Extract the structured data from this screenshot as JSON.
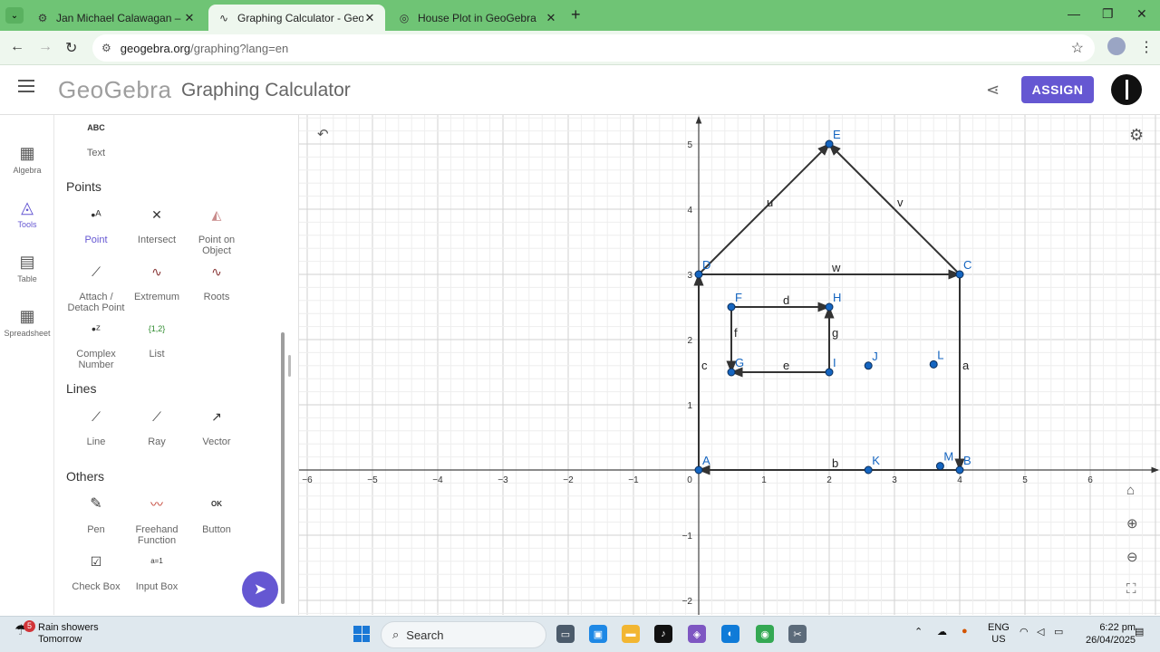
{
  "browser": {
    "tabs": [
      {
        "title": "Jan Michael Calawagan – Resou",
        "icon": "gear-favicon-icon",
        "active": false
      },
      {
        "title": "Graphing Calculator - GeoGebr",
        "icon": "geogebra-favicon-icon",
        "active": true
      },
      {
        "title": "House Plot in GeoGebra",
        "icon": "ai-favicon-icon",
        "active": false
      }
    ],
    "url_host": "geogebra.org",
    "url_path": "/graphing?lang=en"
  },
  "header": {
    "logo": "GeoGebra",
    "title": "Graphing Calculator",
    "assign_label": "ASSIGN"
  },
  "siderail": [
    {
      "label": "Algebra",
      "icon": "calculator-icon",
      "selected": false
    },
    {
      "label": "Tools",
      "icon": "shapes-icon",
      "selected": true
    },
    {
      "label": "Table",
      "icon": "table-icon",
      "selected": false
    },
    {
      "label": "Spreadsheet",
      "icon": "spreadsheet-icon",
      "selected": false
    }
  ],
  "tools": {
    "text_tool": {
      "label": "Text",
      "glyph": "ABC"
    },
    "points_heading": "Points",
    "points": [
      {
        "label": "Point",
        "glyph": "•ᴬ",
        "selected": true
      },
      {
        "label": "Intersect",
        "glyph": "✕"
      },
      {
        "label": "Point on Object",
        "glyph": "◭"
      },
      {
        "label": "Attach / Detach Point",
        "glyph": "⟋"
      },
      {
        "label": "Extremum",
        "glyph": "∿"
      },
      {
        "label": "Roots",
        "glyph": "∿"
      },
      {
        "label": "Complex Number",
        "glyph": "•ᶻ"
      },
      {
        "label": "List",
        "glyph": "{1,2}"
      }
    ],
    "lines_heading": "Lines",
    "lines": [
      {
        "label": "Line",
        "glyph": "⟋"
      },
      {
        "label": "Ray",
        "glyph": "⟋"
      },
      {
        "label": "Vector",
        "glyph": "↗"
      }
    ],
    "others_heading": "Others",
    "others": [
      {
        "label": "Pen",
        "glyph": "✎"
      },
      {
        "label": "Freehand Function",
        "glyph": "〰"
      },
      {
        "label": "Button",
        "glyph": "OK"
      },
      {
        "label": "Check Box",
        "glyph": "☑"
      },
      {
        "label": "Input Box",
        "glyph": "a=1"
      }
    ]
  },
  "graph": {
    "x_ticks": [
      "−6",
      "−5",
      "−4",
      "−3",
      "−2",
      "−1",
      "0",
      "1",
      "2",
      "3",
      "4",
      "5",
      "6"
    ],
    "y_ticks": [
      "−2",
      "−1",
      "1",
      "2",
      "3",
      "4",
      "5"
    ],
    "points": [
      {
        "name": "A",
        "x": 0,
        "y": 0
      },
      {
        "name": "B",
        "x": 4,
        "y": 0
      },
      {
        "name": "C",
        "x": 4,
        "y": 3
      },
      {
        "name": "D",
        "x": 0,
        "y": 3
      },
      {
        "name": "E",
        "x": 2,
        "y": 5
      },
      {
        "name": "F",
        "x": 0.5,
        "y": 2.5
      },
      {
        "name": "G",
        "x": 0.5,
        "y": 1.5
      },
      {
        "name": "H",
        "x": 2,
        "y": 2.5
      },
      {
        "name": "I",
        "x": 2,
        "y": 1.5
      },
      {
        "name": "J",
        "x": 2.6,
        "y": 1.6
      },
      {
        "name": "K",
        "x": 2.6,
        "y": 0
      },
      {
        "name": "L",
        "x": 3.6,
        "y": 1.62
      },
      {
        "name": "M",
        "x": 3.7,
        "y": 0.06
      }
    ],
    "vectors": [
      {
        "name": "a",
        "from": "C",
        "to": "B"
      },
      {
        "name": "b",
        "from": "B",
        "to": "A"
      },
      {
        "name": "c",
        "from": "A",
        "to": "D"
      },
      {
        "name": "w",
        "from": "D",
        "to": "C"
      },
      {
        "name": "u",
        "from": "D",
        "to": "E"
      },
      {
        "name": "v",
        "from": "C",
        "to": "E"
      },
      {
        "name": "d",
        "from": "F",
        "to": "H"
      },
      {
        "name": "g",
        "from": "I",
        "to": "H"
      },
      {
        "name": "e",
        "from": "I",
        "to": "G"
      },
      {
        "name": "f",
        "from": "F",
        "to": "G"
      }
    ]
  },
  "taskbar": {
    "weather_badge": "5",
    "weather_line1": "Rain showers",
    "weather_line2": "Tomorrow",
    "search_label": "Search",
    "lang_line1": "ENG",
    "lang_line2": "US",
    "time": "6:22 pm",
    "date": "26/04/2025"
  }
}
